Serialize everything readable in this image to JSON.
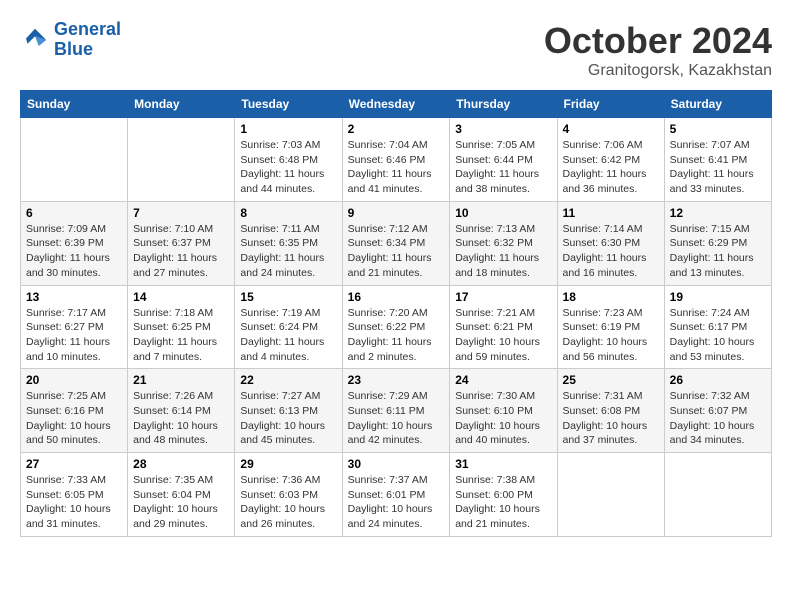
{
  "logo": {
    "line1": "General",
    "line2": "Blue"
  },
  "title": "October 2024",
  "subtitle": "Granitogorsk, Kazakhstan",
  "weekdays": [
    "Sunday",
    "Monday",
    "Tuesday",
    "Wednesday",
    "Thursday",
    "Friday",
    "Saturday"
  ],
  "weeks": [
    [
      {
        "day": "",
        "info": ""
      },
      {
        "day": "",
        "info": ""
      },
      {
        "day": "1",
        "info": "Sunrise: 7:03 AM\nSunset: 6:48 PM\nDaylight: 11 hours and 44 minutes."
      },
      {
        "day": "2",
        "info": "Sunrise: 7:04 AM\nSunset: 6:46 PM\nDaylight: 11 hours and 41 minutes."
      },
      {
        "day": "3",
        "info": "Sunrise: 7:05 AM\nSunset: 6:44 PM\nDaylight: 11 hours and 38 minutes."
      },
      {
        "day": "4",
        "info": "Sunrise: 7:06 AM\nSunset: 6:42 PM\nDaylight: 11 hours and 36 minutes."
      },
      {
        "day": "5",
        "info": "Sunrise: 7:07 AM\nSunset: 6:41 PM\nDaylight: 11 hours and 33 minutes."
      }
    ],
    [
      {
        "day": "6",
        "info": "Sunrise: 7:09 AM\nSunset: 6:39 PM\nDaylight: 11 hours and 30 minutes."
      },
      {
        "day": "7",
        "info": "Sunrise: 7:10 AM\nSunset: 6:37 PM\nDaylight: 11 hours and 27 minutes."
      },
      {
        "day": "8",
        "info": "Sunrise: 7:11 AM\nSunset: 6:35 PM\nDaylight: 11 hours and 24 minutes."
      },
      {
        "day": "9",
        "info": "Sunrise: 7:12 AM\nSunset: 6:34 PM\nDaylight: 11 hours and 21 minutes."
      },
      {
        "day": "10",
        "info": "Sunrise: 7:13 AM\nSunset: 6:32 PM\nDaylight: 11 hours and 18 minutes."
      },
      {
        "day": "11",
        "info": "Sunrise: 7:14 AM\nSunset: 6:30 PM\nDaylight: 11 hours and 16 minutes."
      },
      {
        "day": "12",
        "info": "Sunrise: 7:15 AM\nSunset: 6:29 PM\nDaylight: 11 hours and 13 minutes."
      }
    ],
    [
      {
        "day": "13",
        "info": "Sunrise: 7:17 AM\nSunset: 6:27 PM\nDaylight: 11 hours and 10 minutes."
      },
      {
        "day": "14",
        "info": "Sunrise: 7:18 AM\nSunset: 6:25 PM\nDaylight: 11 hours and 7 minutes."
      },
      {
        "day": "15",
        "info": "Sunrise: 7:19 AM\nSunset: 6:24 PM\nDaylight: 11 hours and 4 minutes."
      },
      {
        "day": "16",
        "info": "Sunrise: 7:20 AM\nSunset: 6:22 PM\nDaylight: 11 hours and 2 minutes."
      },
      {
        "day": "17",
        "info": "Sunrise: 7:21 AM\nSunset: 6:21 PM\nDaylight: 10 hours and 59 minutes."
      },
      {
        "day": "18",
        "info": "Sunrise: 7:23 AM\nSunset: 6:19 PM\nDaylight: 10 hours and 56 minutes."
      },
      {
        "day": "19",
        "info": "Sunrise: 7:24 AM\nSunset: 6:17 PM\nDaylight: 10 hours and 53 minutes."
      }
    ],
    [
      {
        "day": "20",
        "info": "Sunrise: 7:25 AM\nSunset: 6:16 PM\nDaylight: 10 hours and 50 minutes."
      },
      {
        "day": "21",
        "info": "Sunrise: 7:26 AM\nSunset: 6:14 PM\nDaylight: 10 hours and 48 minutes."
      },
      {
        "day": "22",
        "info": "Sunrise: 7:27 AM\nSunset: 6:13 PM\nDaylight: 10 hours and 45 minutes."
      },
      {
        "day": "23",
        "info": "Sunrise: 7:29 AM\nSunset: 6:11 PM\nDaylight: 10 hours and 42 minutes."
      },
      {
        "day": "24",
        "info": "Sunrise: 7:30 AM\nSunset: 6:10 PM\nDaylight: 10 hours and 40 minutes."
      },
      {
        "day": "25",
        "info": "Sunrise: 7:31 AM\nSunset: 6:08 PM\nDaylight: 10 hours and 37 minutes."
      },
      {
        "day": "26",
        "info": "Sunrise: 7:32 AM\nSunset: 6:07 PM\nDaylight: 10 hours and 34 minutes."
      }
    ],
    [
      {
        "day": "27",
        "info": "Sunrise: 7:33 AM\nSunset: 6:05 PM\nDaylight: 10 hours and 31 minutes."
      },
      {
        "day": "28",
        "info": "Sunrise: 7:35 AM\nSunset: 6:04 PM\nDaylight: 10 hours and 29 minutes."
      },
      {
        "day": "29",
        "info": "Sunrise: 7:36 AM\nSunset: 6:03 PM\nDaylight: 10 hours and 26 minutes."
      },
      {
        "day": "30",
        "info": "Sunrise: 7:37 AM\nSunset: 6:01 PM\nDaylight: 10 hours and 24 minutes."
      },
      {
        "day": "31",
        "info": "Sunrise: 7:38 AM\nSunset: 6:00 PM\nDaylight: 10 hours and 21 minutes."
      },
      {
        "day": "",
        "info": ""
      },
      {
        "day": "",
        "info": ""
      }
    ]
  ]
}
